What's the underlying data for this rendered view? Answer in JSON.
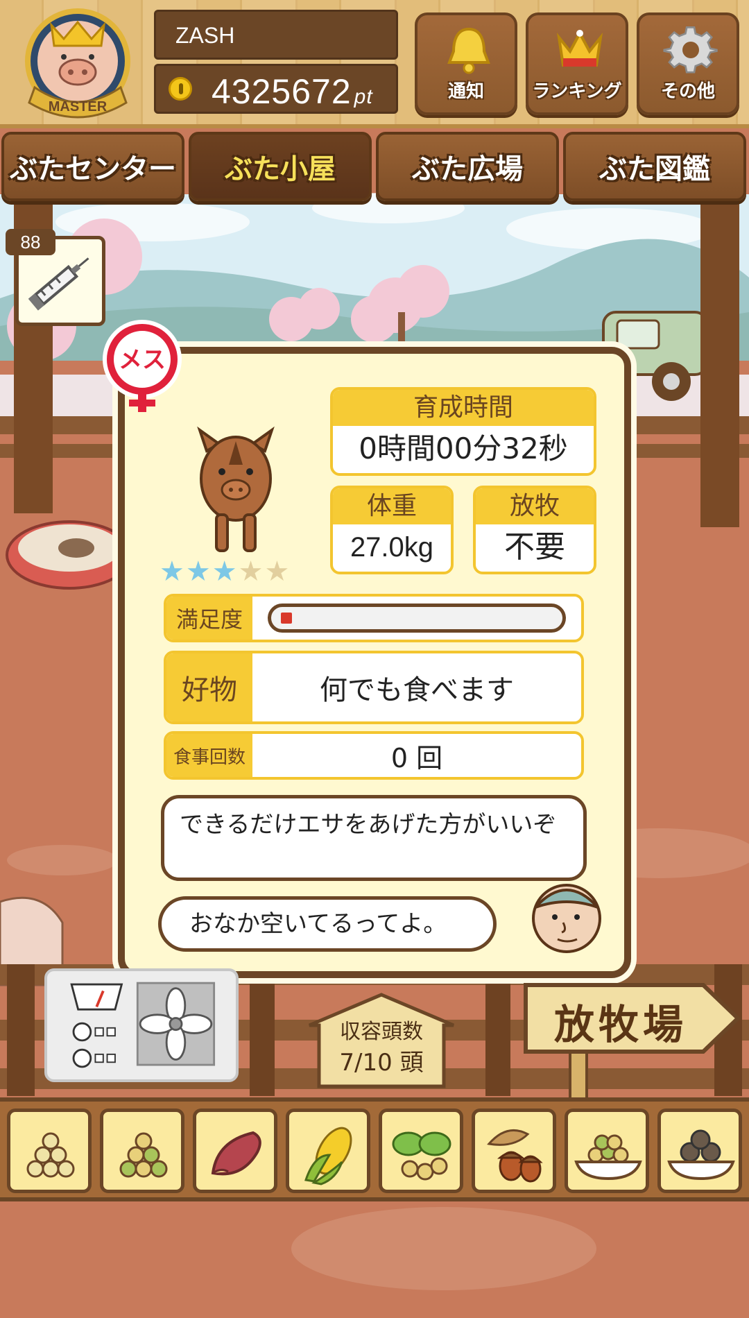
{
  "player": {
    "badge_label": "MASTER",
    "name": "ZASH",
    "points": "4325672",
    "points_unit": "pt"
  },
  "top_buttons": [
    {
      "label": "通知",
      "icon": "bell-icon"
    },
    {
      "label": "ランキング",
      "icon": "crown-icon"
    },
    {
      "label": "その他",
      "icon": "gear-icon"
    }
  ],
  "tabs": [
    {
      "label": "ぶたセンター",
      "active": false
    },
    {
      "label": "ぶた小屋",
      "active": true
    },
    {
      "label": "ぶた広場",
      "active": false
    },
    {
      "label": "ぶた図鑑",
      "active": false
    }
  ],
  "item": {
    "icon": "syringe-icon",
    "count": "88"
  },
  "pig": {
    "gender_label": "メス",
    "stars_total": 5,
    "stars_filled": 3,
    "raising_time_label": "育成時間",
    "raising_time": "0時間00分32秒",
    "weight_label": "体重",
    "weight": "27.0kg",
    "grazing_label": "放牧",
    "grazing": "不要",
    "satisfaction_label": "満足度",
    "satisfaction": 0.04,
    "favorite_label": "好物",
    "favorite": "何でも食べます",
    "meals_label": "食事回数",
    "meals": "0 回"
  },
  "messages": {
    "advice": "できるだけエサをあげた方がいいぞ",
    "status": "おなか空いてるってよ。"
  },
  "capacity": {
    "label": "収容頭数",
    "value": "7/10 頭"
  },
  "pasture_sign": "放牧場",
  "feeds": [
    "feed-grain-icon",
    "feed-mixed-grain-icon",
    "sweet-potato-icon",
    "corn-icon",
    "leafy-greens-icon",
    "acorn-icon",
    "feed-bowl-icon",
    "premium-feed-bowl-icon"
  ],
  "colors": {
    "wood_dark": "#6b4626",
    "card_bg": "#fff9d0",
    "label_yellow": "#f6cb35",
    "satisfaction_red": "#d9392b",
    "star_on": "#7dc8e6",
    "gender_red": "#e0213b"
  }
}
